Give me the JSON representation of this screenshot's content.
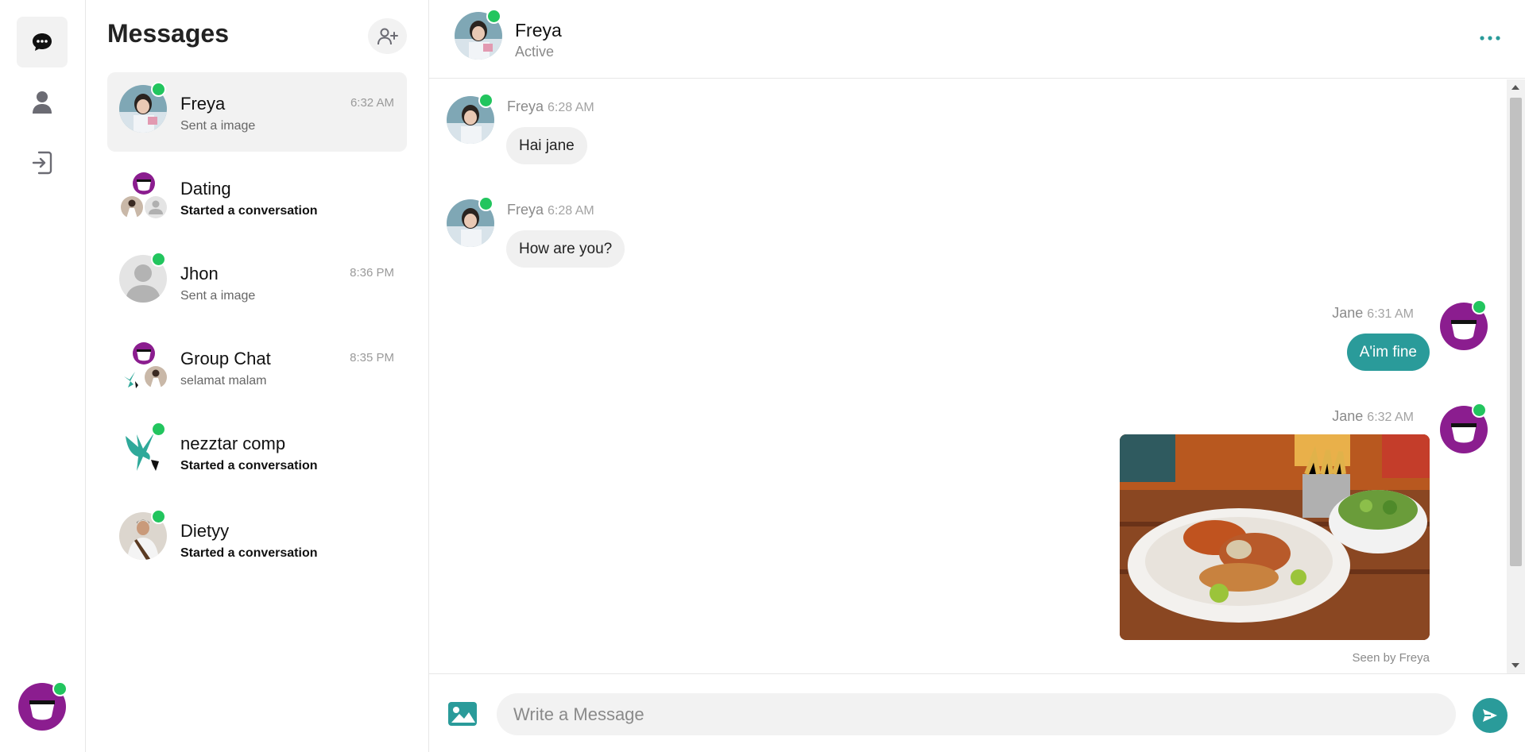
{
  "rail": {
    "items": [
      {
        "name": "chats",
        "icon": "chat-bubble-icon"
      },
      {
        "name": "contacts",
        "icon": "person-icon"
      },
      {
        "name": "logout",
        "icon": "logout-icon"
      }
    ],
    "user_avatar_icon": "jane-avatar-icon"
  },
  "list": {
    "title": "Messages",
    "add_icon": "add-user-icon",
    "conversations": [
      {
        "name": "Freya",
        "sub": "Sent a image",
        "time": "6:32 AM",
        "online": true,
        "active": true
      },
      {
        "name": "Dating",
        "sub": "Started a conversation",
        "time": "",
        "online": false,
        "group": true
      },
      {
        "name": "Jhon",
        "sub": "Sent a image",
        "time": "8:36 PM",
        "online": true
      },
      {
        "name": "Group Chat",
        "sub": "selamat malam",
        "time": "8:35 PM",
        "online": false,
        "group": true
      },
      {
        "name": "nezztar comp",
        "sub": "Started a conversation",
        "time": "",
        "online": true
      },
      {
        "name": "Dietyy",
        "sub": "Started a conversation",
        "time": "",
        "online": true
      }
    ]
  },
  "chat": {
    "header": {
      "name": "Freya",
      "status": "Active",
      "more_icon": "more-horizontal-icon"
    },
    "messages": [
      {
        "sender": "Freya",
        "time": "6:28 AM",
        "text": "Hai jane",
        "direction": "in"
      },
      {
        "sender": "Freya",
        "time": "6:28 AM",
        "text": "How are you?",
        "direction": "in"
      },
      {
        "sender": "Jane",
        "time": "6:31 AM",
        "text": "A'im fine",
        "direction": "out"
      },
      {
        "sender": "Jane",
        "time": "6:32 AM",
        "image": "seafood-plate-photo",
        "direction": "out"
      }
    ],
    "seen": "Seen by Freya",
    "composer": {
      "placeholder": "Write a Message",
      "image_icon": "image-icon",
      "send_icon": "send-icon"
    }
  },
  "colors": {
    "accent": "#2a9b9a",
    "online": "#22c55e",
    "brand_purple": "#8b1d8f"
  }
}
